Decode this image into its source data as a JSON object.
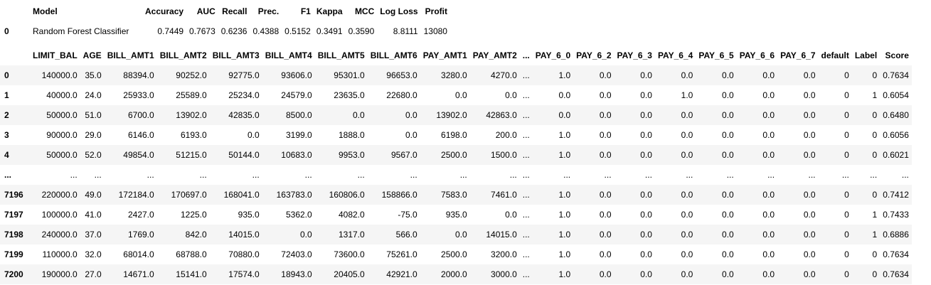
{
  "metrics": {
    "columns": [
      "",
      "Model",
      "Accuracy",
      "AUC",
      "Recall",
      "Prec.",
      "F1",
      "Kappa",
      "MCC",
      "Log Loss",
      "Profit"
    ],
    "rows": [
      [
        "0",
        "Random Forest Classifier",
        "0.7449",
        "0.7673",
        "0.6236",
        "0.4388",
        "0.5152",
        "0.3491",
        "0.3590",
        "8.8111",
        "13080"
      ]
    ]
  },
  "predictions": {
    "columns": [
      "",
      "LIMIT_BAL",
      "AGE",
      "BILL_AMT1",
      "BILL_AMT2",
      "BILL_AMT3",
      "BILL_AMT4",
      "BILL_AMT5",
      "BILL_AMT6",
      "PAY_AMT1",
      "PAY_AMT2",
      "...",
      "PAY_6_0",
      "PAY_6_2",
      "PAY_6_3",
      "PAY_6_4",
      "PAY_6_5",
      "PAY_6_6",
      "PAY_6_7",
      "default",
      "Label",
      "Score"
    ],
    "rows": [
      [
        "0",
        "140000.0",
        "35.0",
        "88394.0",
        "90252.0",
        "92775.0",
        "93606.0",
        "95301.0",
        "96653.0",
        "3280.0",
        "4270.0",
        "...",
        "1.0",
        "0.0",
        "0.0",
        "0.0",
        "0.0",
        "0.0",
        "0.0",
        "0",
        "0",
        "0.7634"
      ],
      [
        "1",
        "40000.0",
        "24.0",
        "25933.0",
        "25589.0",
        "25234.0",
        "24579.0",
        "23635.0",
        "22680.0",
        "0.0",
        "0.0",
        "...",
        "0.0",
        "0.0",
        "0.0",
        "1.0",
        "0.0",
        "0.0",
        "0.0",
        "0",
        "1",
        "0.6054"
      ],
      [
        "2",
        "50000.0",
        "51.0",
        "6700.0",
        "13902.0",
        "42835.0",
        "8500.0",
        "0.0",
        "0.0",
        "13902.0",
        "42863.0",
        "...",
        "0.0",
        "0.0",
        "0.0",
        "0.0",
        "0.0",
        "0.0",
        "0.0",
        "0",
        "0",
        "0.6480"
      ],
      [
        "3",
        "90000.0",
        "29.0",
        "6146.0",
        "6193.0",
        "0.0",
        "3199.0",
        "1888.0",
        "0.0",
        "6198.0",
        "200.0",
        "...",
        "1.0",
        "0.0",
        "0.0",
        "0.0",
        "0.0",
        "0.0",
        "0.0",
        "0",
        "0",
        "0.6056"
      ],
      [
        "4",
        "50000.0",
        "52.0",
        "49854.0",
        "51215.0",
        "50144.0",
        "10683.0",
        "9953.0",
        "9567.0",
        "2500.0",
        "1500.0",
        "...",
        "1.0",
        "0.0",
        "0.0",
        "0.0",
        "0.0",
        "0.0",
        "0.0",
        "0",
        "0",
        "0.6021"
      ],
      [
        "...",
        "...",
        "...",
        "...",
        "...",
        "...",
        "...",
        "...",
        "...",
        "...",
        "...",
        "...",
        "...",
        "...",
        "...",
        "...",
        "...",
        "...",
        "...",
        "...",
        "...",
        "..."
      ],
      [
        "7196",
        "220000.0",
        "49.0",
        "172184.0",
        "170697.0",
        "168041.0",
        "163783.0",
        "160806.0",
        "158866.0",
        "7583.0",
        "7461.0",
        "...",
        "1.0",
        "0.0",
        "0.0",
        "0.0",
        "0.0",
        "0.0",
        "0.0",
        "0",
        "0",
        "0.7412"
      ],
      [
        "7197",
        "100000.0",
        "41.0",
        "2427.0",
        "1225.0",
        "935.0",
        "5362.0",
        "4082.0",
        "-75.0",
        "935.0",
        "0.0",
        "...",
        "1.0",
        "0.0",
        "0.0",
        "0.0",
        "0.0",
        "0.0",
        "0.0",
        "0",
        "1",
        "0.7433"
      ],
      [
        "7198",
        "240000.0",
        "37.0",
        "1769.0",
        "842.0",
        "14015.0",
        "0.0",
        "1317.0",
        "566.0",
        "0.0",
        "14015.0",
        "...",
        "1.0",
        "0.0",
        "0.0",
        "0.0",
        "0.0",
        "0.0",
        "0.0",
        "0",
        "1",
        "0.6886"
      ],
      [
        "7199",
        "110000.0",
        "32.0",
        "68014.0",
        "68788.0",
        "70880.0",
        "72403.0",
        "73600.0",
        "75261.0",
        "2500.0",
        "3200.0",
        "...",
        "1.0",
        "0.0",
        "0.0",
        "0.0",
        "0.0",
        "0.0",
        "0.0",
        "0",
        "0",
        "0.7634"
      ],
      [
        "7200",
        "190000.0",
        "27.0",
        "14671.0",
        "15141.0",
        "17574.0",
        "18943.0",
        "20405.0",
        "42921.0",
        "2000.0",
        "3000.0",
        "...",
        "1.0",
        "0.0",
        "0.0",
        "0.0",
        "0.0",
        "0.0",
        "0.0",
        "0",
        "0",
        "0.7634"
      ]
    ]
  }
}
